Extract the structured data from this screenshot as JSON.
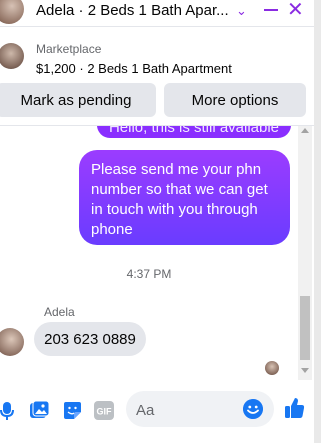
{
  "header": {
    "title": "Adela · 2 Beds 1 Bath Apar...",
    "chevron": "⌄",
    "close": "✕"
  },
  "marketplace": {
    "label": "Marketplace",
    "title": "$1,200 · 2 Beds 1 Bath Apartment"
  },
  "buttons": {
    "pending": "Mark as pending",
    "more": "More options"
  },
  "messages": {
    "out_top_partial": "Hello, this is still available",
    "out_main": "Please send me your phn number so that we can get in touch with you through phone",
    "timestamp": "4:37 PM",
    "sender": "Adela",
    "in_text": "203 623 0889"
  },
  "composer": {
    "placeholder": "Aa"
  },
  "colors": {
    "accent": "#8a2be2",
    "bubble_out": "#8a2eff",
    "bubble_in": "#e4e6eb",
    "icon_blue": "#1877f2"
  },
  "icons": [
    "avatar",
    "chevron-down-icon",
    "minimize-icon",
    "close-icon",
    "mic-icon",
    "image-icon",
    "sticker-icon",
    "gif-icon",
    "emoji-icon",
    "like-icon"
  ]
}
